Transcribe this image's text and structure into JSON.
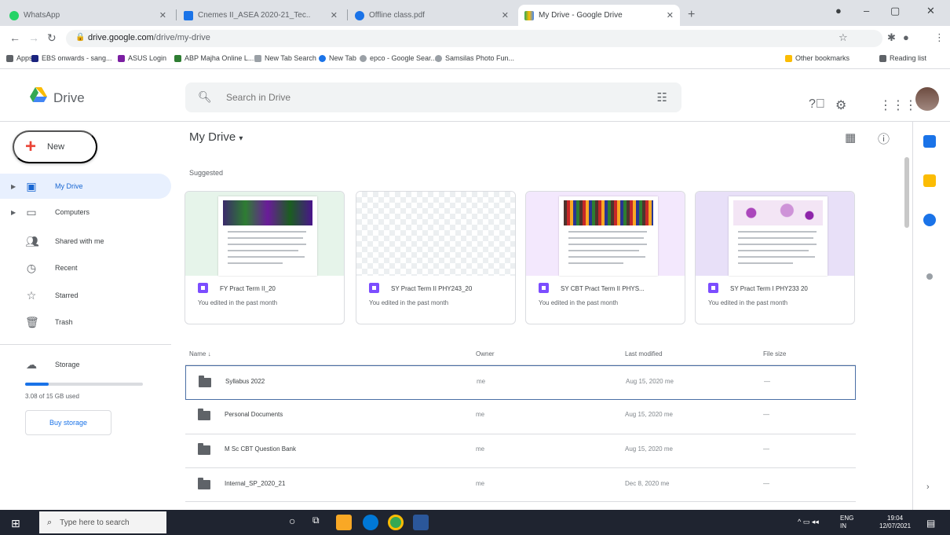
{
  "browser": {
    "tabs": [
      {
        "title": "WhatsApp",
        "color": "#25d366",
        "active": false
      },
      {
        "title": "Cnemes II_ASEA 2020-21_Tec..",
        "color": "#1a73e8",
        "active": false
      },
      {
        "title": "Offline class.pdf",
        "color": "#1a73e8",
        "active": false
      },
      {
        "title": "My Drive - Google Drive",
        "color": "#34a853",
        "active": true
      }
    ],
    "new_tab": "+",
    "url_host": "drive.google.com",
    "url_path": "/drive/my-drive",
    "bookmarks": [
      {
        "label": "Apps",
        "color": "#5f6368"
      },
      {
        "label": "EBS onwards - sang...",
        "color": "#1a237e"
      },
      {
        "label": "ASUS Login",
        "color": "#7b1fa2"
      },
      {
        "label": "ABP Majha Online L...",
        "color": "#2e7d32"
      },
      {
        "label": "New Tab Search",
        "color": "#5f6368"
      },
      {
        "label": "New Tab",
        "color": "#1a73e8"
      },
      {
        "label": "epco - Google Sear...",
        "color": "#5f6368"
      },
      {
        "label": "Samsilas Photo Fun...",
        "color": "#5f6368"
      }
    ],
    "other_bookmarks": "Other bookmarks",
    "reading_list": "Reading list"
  },
  "drive": {
    "logo_text": "Drive",
    "search_placeholder": "Search in Drive",
    "new_label": "New",
    "sidebar": [
      {
        "label": "My Drive",
        "icon": "my-drive-icon",
        "active": true,
        "caret": true
      },
      {
        "label": "Computers",
        "icon": "computer-icon",
        "active": false,
        "caret": true
      },
      {
        "label": "Shared with me",
        "icon": "shared-icon",
        "active": false,
        "caret": false
      },
      {
        "label": "Recent",
        "icon": "clock-icon",
        "active": false,
        "caret": false
      },
      {
        "label": "Starred",
        "icon": "star-icon",
        "active": false,
        "caret": false
      },
      {
        "label": "Trash",
        "icon": "trash-icon",
        "active": false,
        "caret": false
      }
    ],
    "storage_label": "Storage",
    "storage_used": "3.08 of 15 GB used",
    "storage_fraction": 0.2,
    "buy_storage": "Buy storage",
    "main_title": "My Drive",
    "suggested_label": "Suggested",
    "cards": [
      {
        "name": "FY Pract Term II_20",
        "sub": "You edited in the past month",
        "bg": "#e6f4ea",
        "img": "#3b2a6b"
      },
      {
        "name": "SY Pract Term II PHY243_20",
        "sub": "You edited in the past month",
        "bg": "#f1f3f4",
        "img": ""
      },
      {
        "name": "SY CBT Pract Term II PHYS...",
        "sub": "You edited in the past month",
        "bg": "#f3e8fd",
        "img": "#8d6e63"
      },
      {
        "name": "SY Pract Term I PHY233 20",
        "sub": "You edited in the past month",
        "bg": "#e8e0f8",
        "img": "#ce93d8"
      }
    ],
    "columns": {
      "name": "Name",
      "owner": "Owner",
      "modified": "Last modified",
      "size": "File size"
    },
    "files": [
      {
        "name": "Syllabus 2022",
        "owner": "me",
        "modified": "Aug 15, 2020 me",
        "size": "—"
      },
      {
        "name": "Personal Documents",
        "owner": "me",
        "modified": "Aug 15, 2020 me",
        "size": "—"
      },
      {
        "name": "M Sc CBT Question Bank",
        "owner": "me",
        "modified": "Aug 15, 2020 me",
        "size": "—"
      },
      {
        "name": "Internal_SP_2020_21",
        "owner": "me",
        "modified": "Dec 8, 2020 me",
        "size": "—"
      }
    ]
  },
  "taskbar": {
    "search_placeholder": "Type here to search",
    "lang": "ENG",
    "region": "IN",
    "time": "19:04",
    "date": "12/07/2021"
  }
}
